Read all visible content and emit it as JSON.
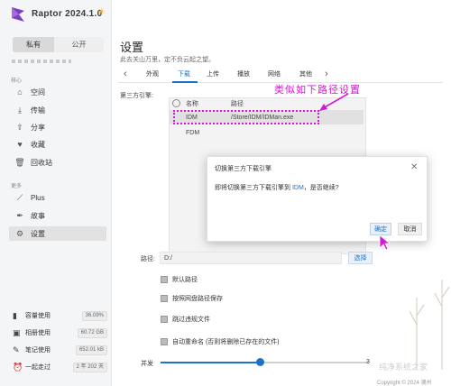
{
  "app": {
    "title": "Raptor 2024.1.0"
  },
  "sidebar": {
    "segments": [
      {
        "label": "私有"
      },
      {
        "label": "公开"
      }
    ],
    "section_main": "核心",
    "items": [
      {
        "label": "空间",
        "icon": "home-icon"
      },
      {
        "label": "传输",
        "icon": "download-icon"
      },
      {
        "label": "分享",
        "icon": "share-icon"
      },
      {
        "label": "收藏",
        "icon": "heart-icon"
      },
      {
        "label": "回收站",
        "icon": "trash-icon"
      }
    ],
    "section_more": "更多",
    "items2": [
      {
        "label": "Plus",
        "icon": "wand-icon"
      },
      {
        "label": "故事",
        "icon": "feather-icon"
      },
      {
        "label": "设置",
        "icon": "gear-icon"
      }
    ],
    "stats": [
      {
        "label": "容量使用",
        "value": "36.09%",
        "icon": "bar-chart-icon"
      },
      {
        "label": "相册使用",
        "value": "60.72 GB",
        "icon": "image-icon"
      },
      {
        "label": "笔记使用",
        "value": "652.01 kB",
        "icon": "note-icon"
      },
      {
        "label": "一起走过",
        "value": "2 年 202 天",
        "icon": "alarm-icon"
      }
    ]
  },
  "main": {
    "title": "设置",
    "subtitle": "此去关山万里，定不负云起之望。",
    "tabs": [
      {
        "label": "外观"
      },
      {
        "label": "下载"
      },
      {
        "label": "上传"
      },
      {
        "label": "播放"
      },
      {
        "label": "网络"
      },
      {
        "label": "其他"
      }
    ],
    "engine_label": "第三方引擎:",
    "engine_table": {
      "headers": [
        "名称",
        "路径"
      ],
      "rows": [
        {
          "name": "IDM",
          "path": "/Store/IDM/IDMan.exe"
        },
        {
          "name": "FDM",
          "path": ""
        }
      ]
    },
    "annotation": "类似如下路径设置",
    "path_label": "路径:",
    "path_value": "D:/",
    "browse_label": "选择",
    "options": [
      {
        "label": "默认路径"
      },
      {
        "label": "按照网盘路径保存"
      },
      {
        "label": "跳过违规文件"
      },
      {
        "label": "自动重命名 (否则将删除已存在的文件)"
      }
    ],
    "concurrency_label": "并发",
    "concurrency_value": "3",
    "copyright": "Copyright © 2024 澳州",
    "watermark": "纯净系统之家"
  },
  "dialog": {
    "title": "切换第三方下载引擎",
    "message_prefix": "即将切换第三方下载引擎到 ",
    "message_engine": "IDM",
    "message_suffix": "，是否继续?",
    "ok_label": "确定",
    "cancel_label": "取消"
  },
  "colors": {
    "accent": "#1a73c9",
    "annotation": "#d31ad0"
  }
}
